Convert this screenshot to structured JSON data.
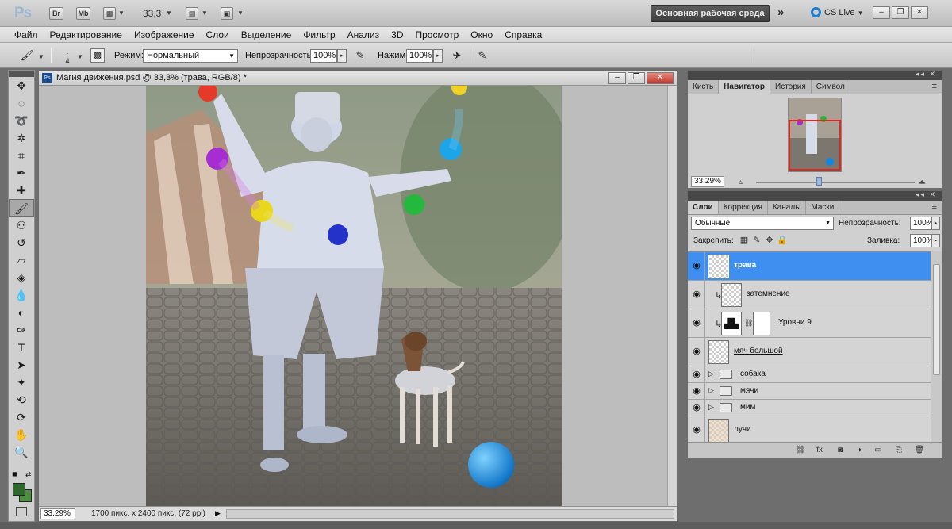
{
  "app": {
    "logo": "Ps",
    "bridge": "Br",
    "minibridge": "Mb",
    "zoom_level": "33,3",
    "workspace_label": "Основная рабочая среда",
    "cs_live": "CS Live"
  },
  "menu": [
    "Файл",
    "Редактирование",
    "Изображение",
    "Слои",
    "Выделение",
    "Фильтр",
    "Анализ",
    "3D",
    "Просмотр",
    "Окно",
    "Справка"
  ],
  "options": {
    "brush_size": "4",
    "mode_label": "Режим:",
    "mode_value": "Нормальный",
    "opacity_label": "Непрозрачность:",
    "opacity_value": "100%",
    "pressure_label": "Нажим:",
    "pressure_value": "100%"
  },
  "document": {
    "title": "Магия движения.psd @ 33,3% (трава, RGB/8) *",
    "status_zoom": "33,29%",
    "status_info": "1700 пикс. x 2400 пикс. (72 ppi)"
  },
  "navigator": {
    "tabs": [
      "Кисть",
      "Навигатор",
      "История",
      "Символ"
    ],
    "active_tab": 1,
    "zoom": "33.29%"
  },
  "layers_panel": {
    "tabs": [
      "Слои",
      "Коррекция",
      "Каналы",
      "Маски"
    ],
    "active_tab": 0,
    "blend_mode": "Обычные",
    "opacity_label": "Непрозрачность:",
    "opacity_value": "100%",
    "lock_label": "Закрепить:",
    "fill_label": "Заливка:",
    "fill_value": "100%",
    "layers": [
      {
        "name": "трава",
        "type": "pixel",
        "active": true
      },
      {
        "name": "затемнение",
        "type": "clipped"
      },
      {
        "name": "Уровни 9",
        "type": "adjustment"
      },
      {
        "name": "мяч большой",
        "type": "pixel"
      },
      {
        "name": "собака",
        "type": "group"
      },
      {
        "name": "мячи",
        "type": "group"
      },
      {
        "name": "мим",
        "type": "group"
      },
      {
        "name": "лучи",
        "type": "pixel"
      }
    ]
  },
  "colors": {
    "foreground": "#2e6a2c",
    "background": "#4d8f3e",
    "selection": "#3e8ff0",
    "workspace_button": "#4a4a4a"
  },
  "icons": [
    "move-icon",
    "marquee-icon",
    "lasso-icon",
    "quick-select-icon",
    "crop-icon",
    "eyedropper-icon",
    "healing-icon",
    "brush-icon",
    "stamp-icon",
    "history-brush-icon",
    "eraser-icon",
    "bucket-icon",
    "dodge-icon",
    "pen-icon",
    "type-icon",
    "path-select-icon",
    "shape-icon",
    "3d-rotate-icon",
    "3d-orbit-icon",
    "hand-icon",
    "zoom-icon"
  ]
}
